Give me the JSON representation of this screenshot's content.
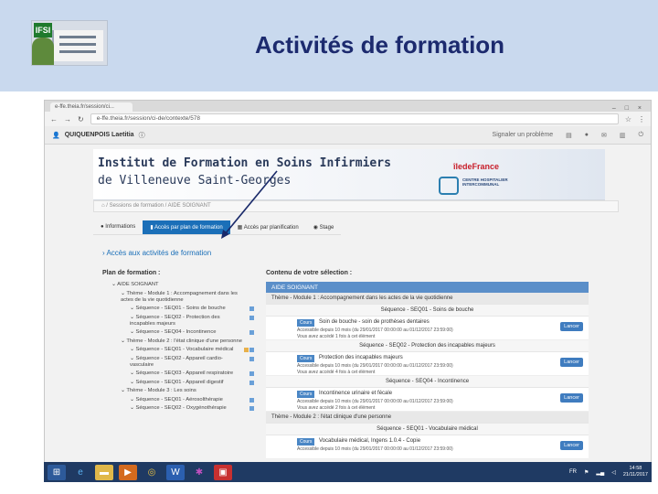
{
  "slide": {
    "title": "Activités de formation",
    "logo_text": "IFSI"
  },
  "browser": {
    "tab_label": "e-ffe.theia.fr/session/ci...",
    "url": "e-ffe.theia.fr/session/ci-de/contexte/578",
    "window_controls": "– □ ×"
  },
  "userbar": {
    "user": "QUIQUENPOIS Laetitia",
    "signal": "Signaler un problème"
  },
  "banner": {
    "line1": "Institut de Formation en Soins Infirmiers",
    "line2": "de Villeneuve Saint-Georges",
    "region": "îledeFrance",
    "hospital": "CENTRE HOSPITALIER INTERCOMMUNAL"
  },
  "breadcrumb": "⌂  /  Sessions de formation  /  AIDE SOIGNANT",
  "nav": {
    "tabs": [
      "Informations",
      "Accès par plan de formation",
      "Accès par planification",
      "Stage"
    ]
  },
  "section_link": "Accès aux activités de formation",
  "left": {
    "title": "Plan de formation :",
    "items": [
      "AIDE SOIGNANT",
      "Thème - Module 1 : Accompagnement dans les actes de la vie quotidienne",
      "Séquence - SEQ01 - Soins de bouche",
      "Séquence - SEQ02 - Protection des incapables majeurs",
      "Séquence - SEQ04 - Incontinence",
      "Thème - Module 2 : l'état clinique d'une personne",
      "Séquence - SEQ01 - Vocabulaire médical",
      "Séquence - SEQ02 - Appareil cardio-vasculaire",
      "Séquence - SEQ03 - Appareil respiratoire",
      "Séquence - SEQ01 - Appareil digestif",
      "Thème - Module 3 : Les soins",
      "Séquence - SEQ01 - Aérosolthérapie",
      "Séquence - SEQ02 - Oxygénothérapie"
    ]
  },
  "right": {
    "title": "Contenu de votre sélection :",
    "head": "AIDE SOIGNANT",
    "theme1": "Thème - Module 1 : Accompagnement dans les actes de la vie quotidienne",
    "theme2": "Thème - Module 2 : l'état clinique d'une personne",
    "seqs": [
      "Séquence - SEQ01 - Soins de bouche",
      "Séquence - SEQ02 - Protection des incapables majeurs",
      "Séquence - SEQ04 - Incontinence",
      "Séquence - SEQ01 - Vocabulaire médical"
    ],
    "modules": [
      {
        "tag": "Cours",
        "title": "Soin de bouche - soin de prothèses dentaires",
        "access": "Accessible depuis 10 mois (du 29/01/2017 00:00:00 au 01/12/2017 23:59:00)",
        "views": "Vous avez accédé 1 fois à cet élément",
        "button": "Lancer"
      },
      {
        "tag": "Cours",
        "title": "Protection des incapables majeurs",
        "access": "Accessible depuis 10 mois (du 29/01/2017 00:00:00 au 01/12/2017 23:59:00)",
        "views": "Vous avez accédé 4 fois à cet élément",
        "button": "Lancer"
      },
      {
        "tag": "Cours",
        "title": "Incontinence urinaire et fécale",
        "access": "Accessible depuis 10 mois (du 29/01/2017 00:00:00 au 01/12/2017 23:59:00)",
        "views": "Vous avez accédé 2 fois à cet élément",
        "button": "Lancer"
      },
      {
        "tag": "Cours",
        "title": "Vocabulaire médical, Ingens 1.0.4 - Copie",
        "access": "Accessible depuis 10 mois (du 29/01/2017 00:00:00 au 01/12/2017 23:59:00)",
        "views": "",
        "button": "Lancer"
      }
    ]
  },
  "taskbar": {
    "lang": "FR",
    "time": "14:58",
    "date": "21/11/2017"
  }
}
